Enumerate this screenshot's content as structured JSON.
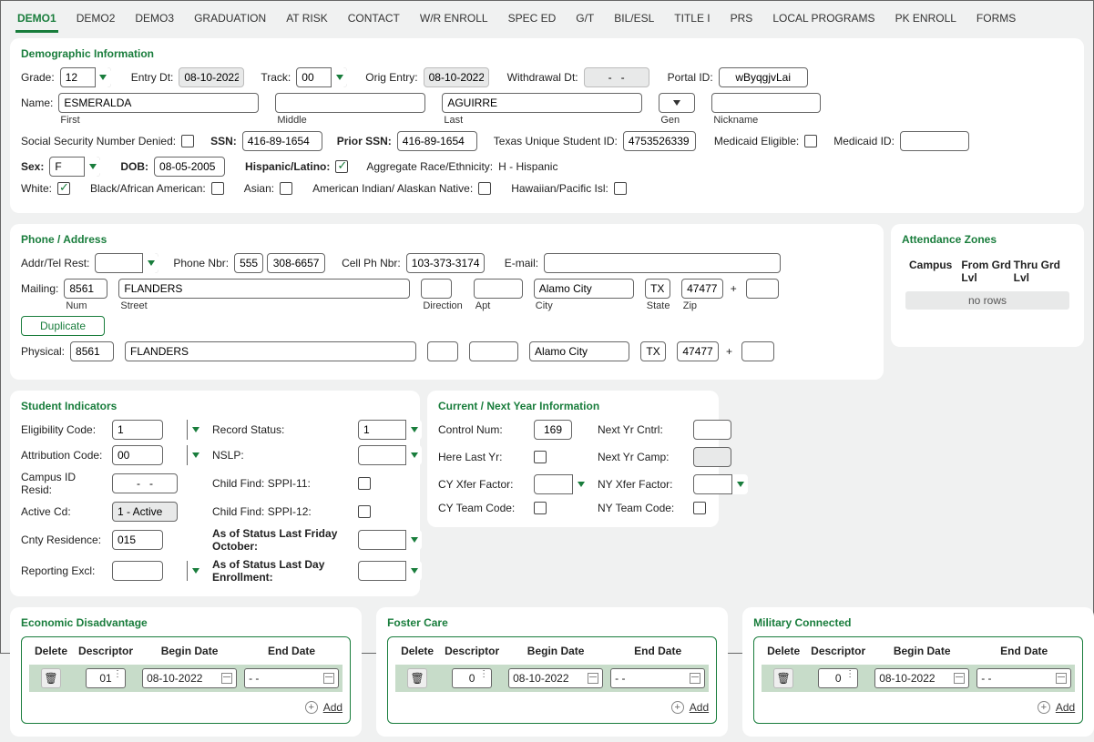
{
  "tabs": [
    "DEMO1",
    "DEMO2",
    "DEMO3",
    "GRADUATION",
    "AT RISK",
    "CONTACT",
    "W/R ENROLL",
    "SPEC ED",
    "G/T",
    "BIL/ESL",
    "TITLE I",
    "PRS",
    "LOCAL PROGRAMS",
    "PK ENROLL",
    "FORMS"
  ],
  "active_tab": "DEMO1",
  "demo": {
    "title": "Demographic Information",
    "grade_label": "Grade:",
    "grade": "12",
    "entry_dt_label": "Entry Dt:",
    "entry_dt": "08-10-2022",
    "track_label": "Track:",
    "track": "00",
    "orig_entry_label": "Orig Entry:",
    "orig_entry": "08-10-2022",
    "withdrawal_dt_label": "Withdrawal Dt:",
    "withdrawal_dt": " -   - ",
    "portal_id_label": "Portal ID:",
    "portal_id": "wByqgjvLai",
    "name_label": "Name:",
    "first": "ESMERALDA",
    "middle": "",
    "last": "AGUIRRE",
    "gen": "",
    "nickname": "",
    "first_lbl": "First",
    "middle_lbl": "Middle",
    "last_lbl": "Last",
    "gen_lbl": "Gen",
    "nickname_lbl": "Nickname",
    "ssn_denied_label": "Social Security Number Denied:",
    "ssn_denied": false,
    "ssn_label": "SSN:",
    "ssn": "416-89-1654",
    "prior_ssn_label": "Prior SSN:",
    "prior_ssn": "416-89-1654",
    "tx_usid_label": "Texas Unique Student ID:",
    "tx_usid": "4753526339",
    "medicaid_elig_label": "Medicaid Eligible:",
    "medicaid_elig": false,
    "medicaid_id_label": "Medicaid ID:",
    "medicaid_id": "",
    "sex_label": "Sex:",
    "sex": "F",
    "dob_label": "DOB:",
    "dob": "08-05-2005",
    "hisp_label": "Hispanic/Latino:",
    "hisp": true,
    "agg_label": "Aggregate Race/Ethnicity:",
    "agg": "H - Hispanic",
    "race_white_label": "White:",
    "race_white": true,
    "race_black_label": "Black/African American:",
    "race_black": false,
    "race_asian_label": "Asian:",
    "race_asian": false,
    "race_aian_label": "American Indian/ Alaskan Native:",
    "race_aian": false,
    "race_hpi_label": "Hawaiian/Pacific Isl:",
    "race_hpi": false
  },
  "phone": {
    "title": "Phone / Address",
    "addr_tel_rest_label": "Addr/Tel Rest:",
    "phone_nbr_label": "Phone Nbr:",
    "phone_area": "555",
    "phone_num": "308-6657",
    "cell_label": "Cell Ph Nbr:",
    "cell": "103-373-3174",
    "email_label": "E-mail:",
    "email": "",
    "mailing_label": "Mailing:",
    "physical_label": "Physical:",
    "num_lbl": "Num",
    "street_lbl": "Street",
    "direction_lbl": "Direction",
    "apt_lbl": "Apt",
    "city_lbl": "City",
    "state_lbl": "State",
    "zip_lbl": "Zip",
    "mail": {
      "num": "8561",
      "street": "FLANDERS",
      "dir": "",
      "apt": "",
      "city": "Alamo City",
      "state": "TX",
      "zip": "47477",
      "zip4": ""
    },
    "phys": {
      "num": "8561",
      "street": "FLANDERS",
      "dir": "",
      "apt": "",
      "city": "Alamo City",
      "state": "TX",
      "zip": "47477",
      "zip4": ""
    },
    "duplicate_btn": "Duplicate"
  },
  "att_zones": {
    "title": "Attendance Zones",
    "h1": "Campus",
    "h2": "From Grd Lvl",
    "h3": "Thru Grd Lvl",
    "no_rows": "no rows"
  },
  "indicators": {
    "title": "Student Indicators",
    "elig_code_lbl": "Eligibility Code:",
    "elig_code": "1",
    "attrib_code_lbl": "Attribution Code:",
    "attrib_code": "00",
    "campus_id_lbl": "Campus ID Resid:",
    "campus_id": " -   - ",
    "active_cd_lbl": "Active Cd:",
    "active_cd": "1 - Active",
    "cnty_res_lbl": "Cnty Residence:",
    "cnty_res": "015",
    "rep_excl_lbl": "Reporting Excl:",
    "rep_excl": "",
    "rec_status_lbl": "Record Status:",
    "rec_status": "1",
    "nslp_lbl": "NSLP:",
    "nslp": "",
    "cf11_lbl": "Child Find: SPPI-11:",
    "cf11": false,
    "cf12_lbl": "Child Find: SPPI-12:",
    "cf12": false,
    "as_of_oct_lbl": "As of Status Last Friday October:",
    "as_of_oct": "",
    "as_of_enr_lbl": "As of Status Last Day Enrollment:",
    "as_of_enr": ""
  },
  "cyny": {
    "title": "Current / Next Year Information",
    "control_num_lbl": "Control Num:",
    "control_num": "169",
    "ny_cntrl_lbl": "Next Yr Cntrl:",
    "ny_cntrl": "",
    "here_last_yr_lbl": "Here Last Yr:",
    "here_last_yr": false,
    "ny_camp_lbl": "Next Yr Camp:",
    "ny_camp": "",
    "cy_xfer_lbl": "CY Xfer Factor:",
    "cy_xfer": "",
    "ny_xfer_lbl": "NY Xfer Factor:",
    "ny_xfer": "",
    "cy_team_lbl": "CY Team Code:",
    "cy_team": false,
    "ny_team_lbl": "NY Team Code:",
    "ny_team": false
  },
  "econ": {
    "title": "Economic Disadvantage",
    "h_delete": "Delete",
    "h_desc": "Descriptor",
    "h_begin": "Begin Date",
    "h_end": "End Date",
    "row": {
      "desc": "01",
      "begin": "08-10-2022",
      "end": " -   - "
    },
    "add": "Add"
  },
  "foster": {
    "title": "Foster Care",
    "h_delete": "Delete",
    "h_desc": "Descriptor",
    "h_begin": "Begin Date",
    "h_end": "End Date",
    "row": {
      "desc": "0",
      "begin": "08-10-2022",
      "end": " -   - "
    },
    "add": "Add"
  },
  "military": {
    "title": "Military Connected",
    "h_delete": "Delete",
    "h_desc": "Descriptor",
    "h_begin": "Begin Date",
    "h_end": "End Date",
    "row": {
      "desc": "0",
      "begin": "08-10-2022",
      "end": " -   - "
    },
    "add": "Add"
  }
}
